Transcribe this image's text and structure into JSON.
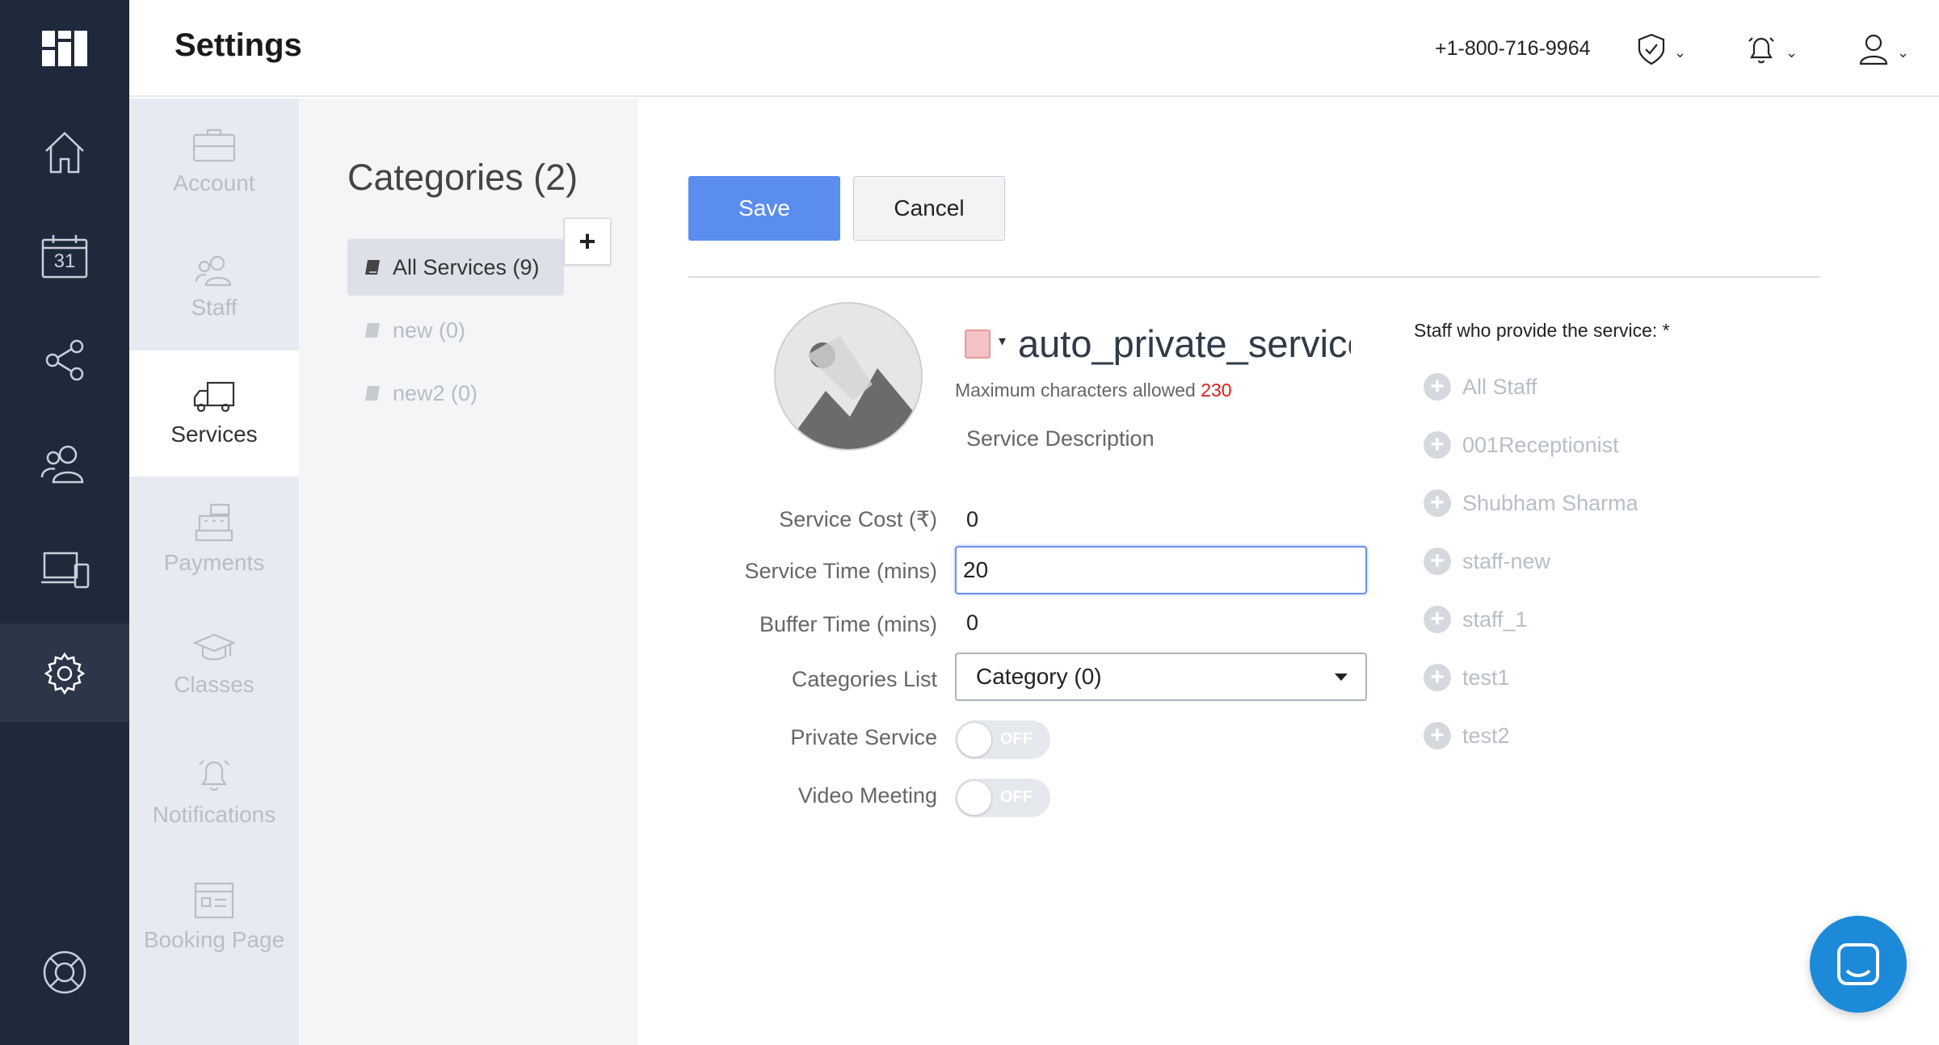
{
  "header": {
    "title": "Settings",
    "phone": "+1-800-716-9964"
  },
  "rail": {
    "icons": [
      "logo-icon",
      "home-icon",
      "calendar-icon",
      "share-icon",
      "customers-icon",
      "devices-icon",
      "gear-icon",
      "help-icon"
    ],
    "calendar_day": "31",
    "active": "settings"
  },
  "subnav": {
    "items": [
      {
        "label": "Account",
        "icon": "briefcase-icon"
      },
      {
        "label": "Staff",
        "icon": "staff-icon"
      },
      {
        "label": "Services",
        "icon": "truck-icon"
      },
      {
        "label": "Payments",
        "icon": "cash-register-icon"
      },
      {
        "label": "Classes",
        "icon": "graduation-cap-icon"
      },
      {
        "label": "Notifications",
        "icon": "bell-icon"
      },
      {
        "label": "Booking Page",
        "icon": "booking-page-icon"
      }
    ],
    "active": "Services"
  },
  "categories": {
    "title": "Categories (2)",
    "add_label": "+",
    "items": [
      {
        "label": "All Services (9)"
      },
      {
        "label": "new (0)"
      },
      {
        "label": "new2 (0)"
      }
    ]
  },
  "form": {
    "save_label": "Save",
    "cancel_label": "Cancel",
    "service_name": "auto_private_service",
    "max_chars_label": "Maximum characters allowed",
    "max_chars_value": "230",
    "description_placeholder": "Service Description",
    "cost_label": "Service Cost (₹)",
    "cost_value": "0",
    "time_label": "Service Time (mins)",
    "time_value": "20",
    "buffer_label": "Buffer Time (mins)",
    "buffer_value": "0",
    "categories_label": "Categories List",
    "categories_value": "Category (0)",
    "private_label": "Private Service",
    "private_state": "OFF",
    "video_label": "Video Meeting",
    "video_state": "OFF",
    "swatch_color": "#f4c1c4"
  },
  "staff": {
    "title": "Staff who provide the service: *",
    "items": [
      "All Staff",
      "001Receptionist",
      "Shubham Sharma",
      "staff-new",
      "staff_1",
      "test1",
      "test2"
    ]
  },
  "colors": {
    "rail": "#1e2a3b",
    "accent": "#5b8def",
    "chat": "#1c8ad8",
    "error": "#e01b1b"
  }
}
